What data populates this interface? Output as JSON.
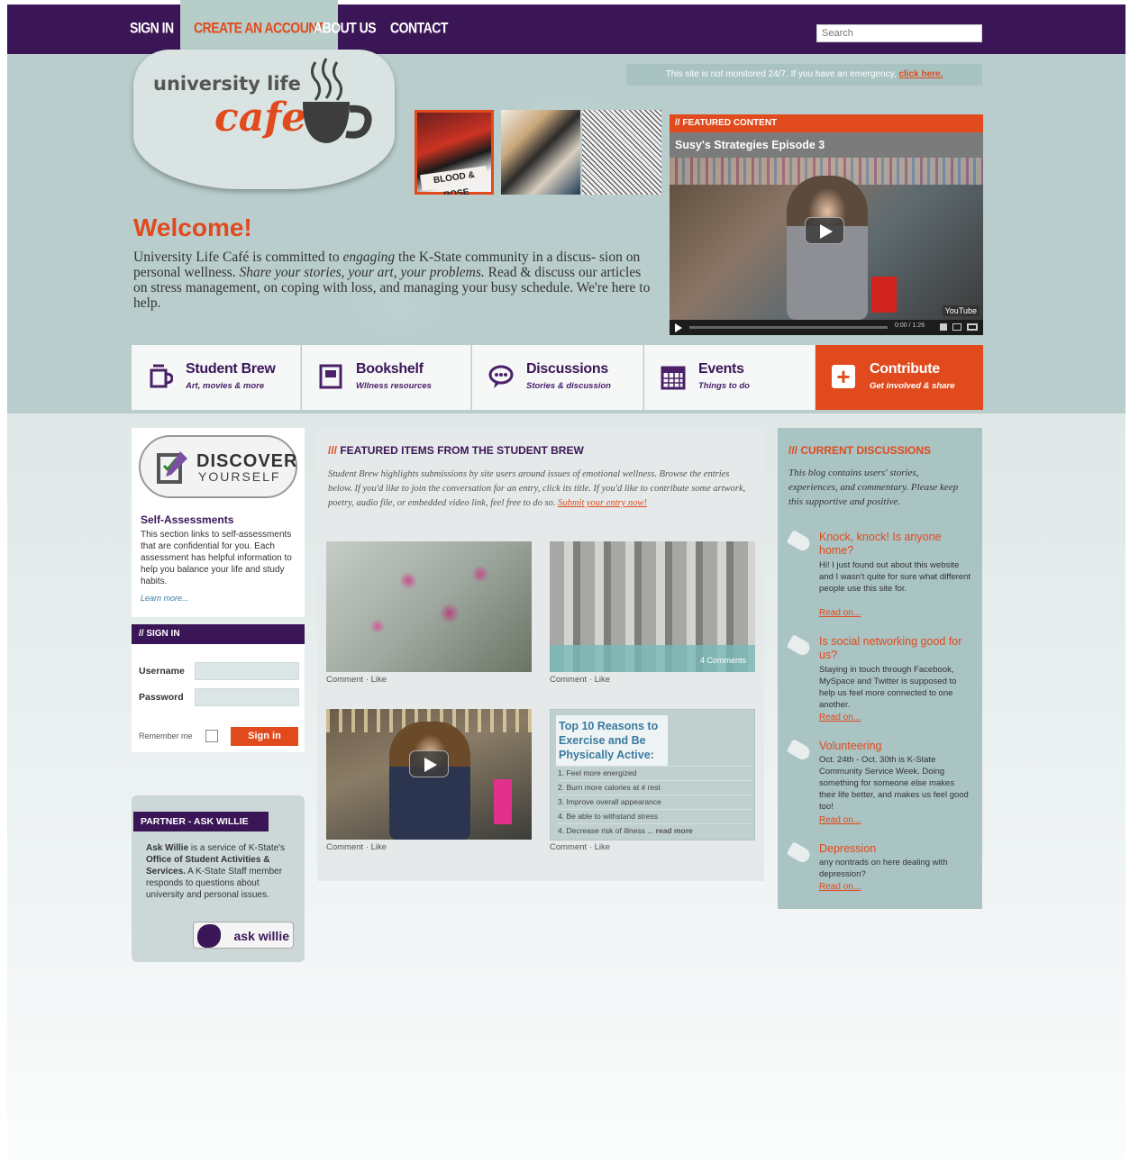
{
  "nav": {
    "sign_in": "SIGN IN",
    "create_account": "CREATE AN ACCOUNT",
    "about": "ABOUT US",
    "contact": "CONTACT",
    "search_placeholder": "Search"
  },
  "emergency": {
    "text": "This site is not monitored 24/7. If you have an emergency,",
    "link": "click here."
  },
  "logo": {
    "line1": "university life",
    "line2": "cafe"
  },
  "thumbnails": [
    "Blood & Rose",
    "artwork-2",
    "artwork-3"
  ],
  "thumb_caption": "BLOOD & ROSE",
  "welcome": {
    "title": "Welcome!",
    "p1": "University Life Café is committed to ",
    "p1_em": "engaging",
    "p2": " the K-State community in a discus- sion on personal wellness. ",
    "p2_em": "Share your stories, your art, your problems.",
    "p3": " Read & discuss our articles on stress management, on coping with loss, and managing your busy schedule. We're here to help."
  },
  "featured": {
    "header": "// FEATURED CONTENT",
    "title": "Susy's Strategies Episode 3",
    "youtube": "YouTube",
    "time": "0:00 / 1:26"
  },
  "tabs": [
    {
      "title": "Student Brew",
      "sub": "Art, movies & more"
    },
    {
      "title": "Bookshelf",
      "sub": "Wllness resources"
    },
    {
      "title": "Discussions",
      "sub": "Stories & discussion"
    },
    {
      "title": "Events",
      "sub": "Things to do"
    },
    {
      "title": "Contribute",
      "sub": "Get involved & share"
    }
  ],
  "discover": {
    "line1": "DISCOVER",
    "line2": "YOURSELF",
    "title": "Self-Assessments",
    "text": "This section links to self-assessments that are confidential for you. Each assessment has helpful information to help you balance your life and study habits.",
    "more": "Learn more..."
  },
  "signin": {
    "header": "// SIGN IN",
    "username": "Username",
    "password": "Password",
    "remember": "Remember me",
    "button": "Sign in"
  },
  "willie": {
    "header": "PARTNER - ASK WILLIE",
    "text_b1": "Ask Willie",
    "text_1": " is a service of K-State's ",
    "text_b2": "Office of Student Activities & Services.",
    "text_2": " A K-State Staff member responds to questions about university and personal issues.",
    "logo": "ask willie"
  },
  "brew": {
    "prefix": "///",
    "header": " FEATURED ITEMS FROM THE STUDENT BREW",
    "text": "Student Brew highlights submissions by site users around issues of emotional wellness. Browse the entries below. If you'd like to join the conversation for an entry, click its title. If you'd like to contribute some artwork, poetry, audio file, or embedded video link, feel free to do so. ",
    "link": "Submit your entry now!",
    "comment": "Comment",
    "like": "Like",
    "comments_count": "4 Comments",
    "top10_title": "Top 10 Reasons to Exercise and Be Physically Active:",
    "top10_items": [
      "1. Feel more energized",
      "2. Burn more calories at # rest",
      "3. Improve overall appearance",
      "4. Be able to withstand stress",
      "4. Decrease risk of illness ..."
    ],
    "top10_more": "read more"
  },
  "discussions": {
    "prefix": "///",
    "header": " CURRENT DISCUSSIONS",
    "intro": "This blog contains users' stories, experiences, and commentary. Please keep this supportive and positive.",
    "read_on": "Read on...",
    "items": [
      {
        "title": "Knock, knock! Is anyone home?",
        "body": "Hi! I just found out about this website and I wasn't quite for sure what different people use this site for."
      },
      {
        "title": "Is social networking good for us?",
        "body": "Staying in touch through Facebook, MySpace and Twitter is supposed to help us feel more connected to one another."
      },
      {
        "title": "Volunteering",
        "body": "Oct. 24th - Oct. 30th is K-State Community Service Week. Doing something for someone else makes their life better, and makes us feel good too!"
      },
      {
        "title": "Depression",
        "body": "any nontrads on here dealing with depression?"
      }
    ]
  }
}
